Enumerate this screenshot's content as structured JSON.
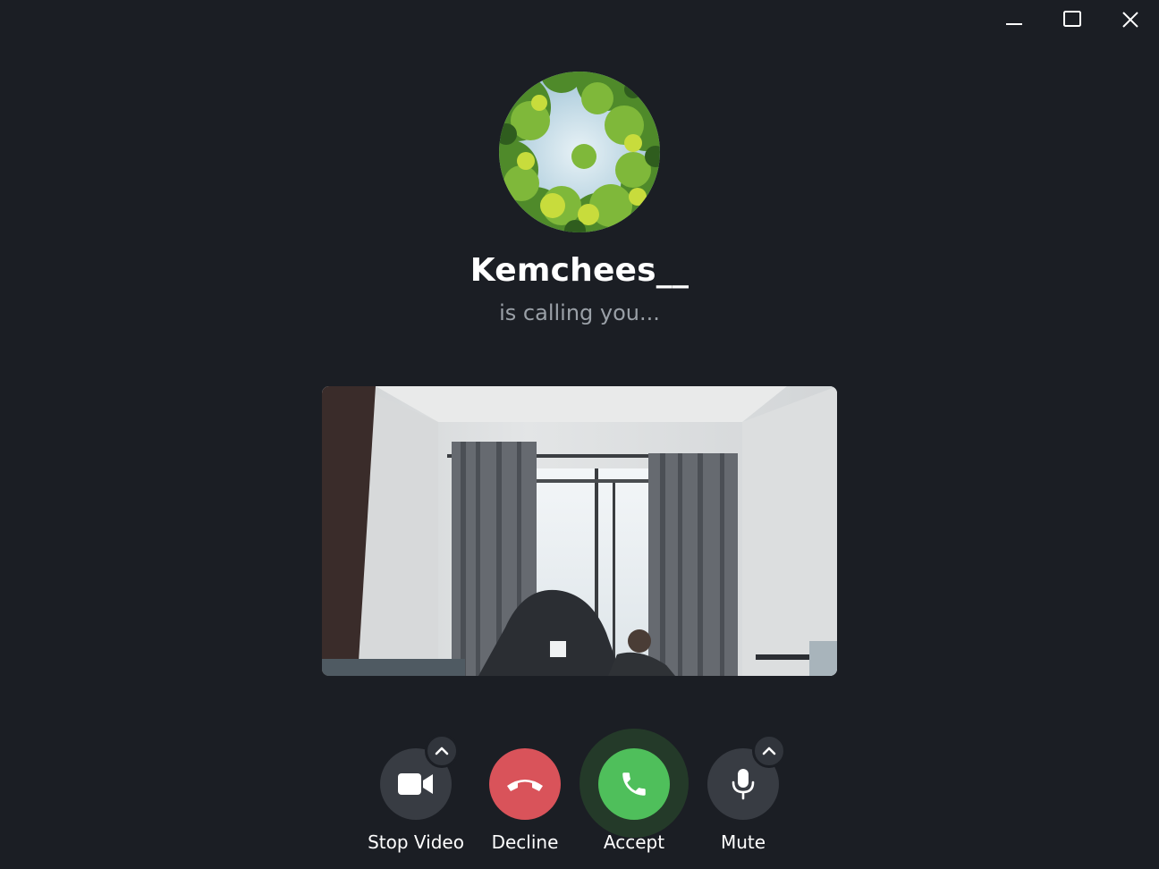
{
  "window": {
    "controls": {
      "minimize_icon": "minimize-icon",
      "maximize_icon": "maximize-icon",
      "close_icon": "close-icon"
    }
  },
  "caller": {
    "name": "Kemchees__",
    "status": "is calling you...",
    "avatar": "tree-canopy-photo"
  },
  "video_preview": {
    "content": "camera-self-view"
  },
  "controls": {
    "stop_video": {
      "label": "Stop Video",
      "icon": "video-camera-icon"
    },
    "decline": {
      "label": "Decline",
      "icon": "phone-hangup-icon"
    },
    "accept": {
      "label": "Accept",
      "icon": "phone-icon"
    },
    "mute": {
      "label": "Mute",
      "icon": "microphone-icon"
    }
  },
  "colors": {
    "background": "#1b1e24",
    "decline": "#d9535a",
    "accept": "#4fbf5b",
    "neutral_button": "#383c43",
    "status_text": "#9aa0a7"
  }
}
